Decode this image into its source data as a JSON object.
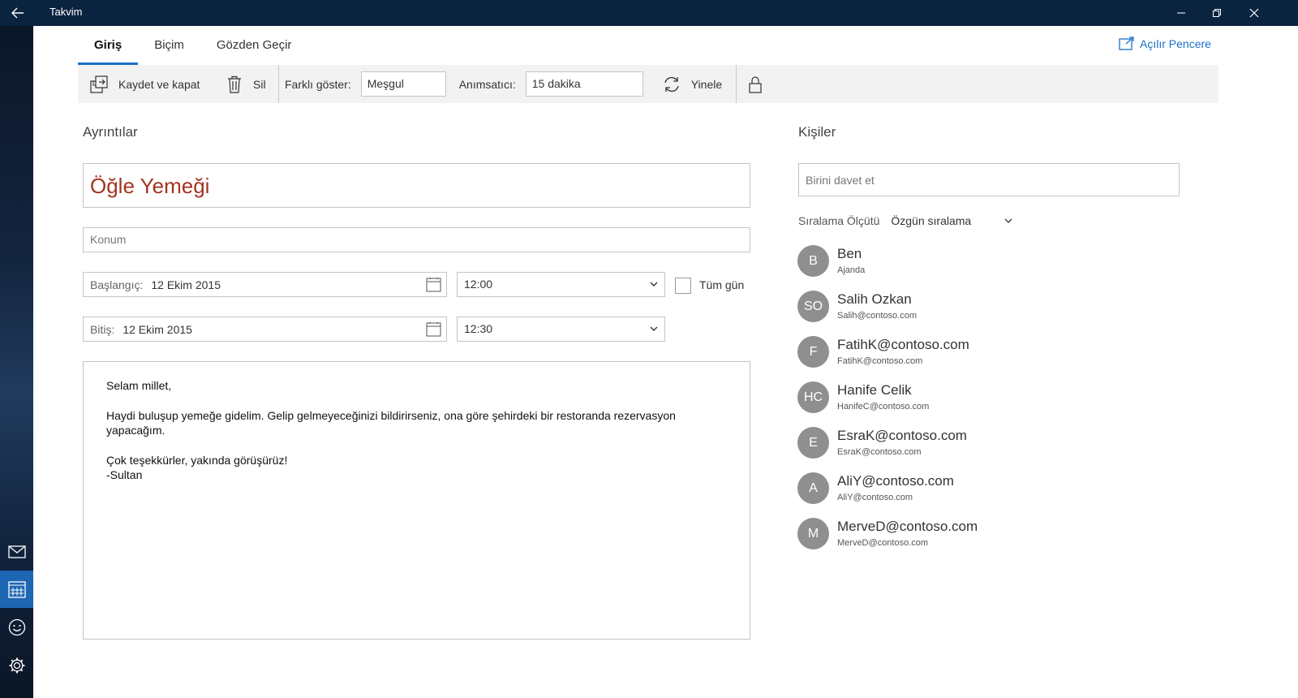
{
  "window": {
    "title": "Takvim"
  },
  "tabs": [
    {
      "label": "Giriş",
      "active": true
    },
    {
      "label": "Biçim",
      "active": false
    },
    {
      "label": "Gözden Geçir",
      "active": false
    }
  ],
  "popout": {
    "label": "Açılır Pencere"
  },
  "toolbar": {
    "save_close": "Kaydet ve kapat",
    "delete": "Sil",
    "show_as_label": "Farklı göster:",
    "show_as_value": "Meşgul",
    "reminder_label": "Anımsatıcı:",
    "reminder_value": "15 dakika",
    "repeat": "Yinele"
  },
  "details": {
    "heading": "Ayrıntılar",
    "subject": "Öğle Yemeği",
    "location_placeholder": "Konum",
    "start_label": "Başlangıç:",
    "start_date": "12 Ekim 2015",
    "start_time": "12:00",
    "end_label": "Bitiş:",
    "end_date": "12 Ekim 2015",
    "end_time": "12:30",
    "all_day_label": "Tüm gün",
    "all_day_checked": false,
    "body_paragraphs": [
      "Selam millet,",
      "Haydi buluşup yemeğe gidelim. Gelip gelmeyeceğinizi bildirirseniz, ona göre şehirdeki bir restoranda rezervasyon yapacağım.",
      "Çok teşekkürler, yakında görüşürüz!\n-Sultan"
    ]
  },
  "people": {
    "heading": "Kişiler",
    "invite_placeholder": "Birini davet et",
    "sort_label": "Sıralama Ölçütü",
    "sort_value": "Özgün sıralama",
    "list": [
      {
        "initials": "B",
        "name": "Ben",
        "email": "Ajanda"
      },
      {
        "initials": "SO",
        "name": "Salih Ozkan",
        "email": "Salih@contoso.com"
      },
      {
        "initials": "F",
        "name": "FatihK@contoso.com",
        "email": "FatihK@contoso.com"
      },
      {
        "initials": "HC",
        "name": "Hanife Celik",
        "email": "HanifeC@contoso.com"
      },
      {
        "initials": "E",
        "name": "EsraK@contoso.com",
        "email": "EsraK@contoso.com"
      },
      {
        "initials": "A",
        "name": "AliY@contoso.com",
        "email": "AliY@contoso.com"
      },
      {
        "initials": "M",
        "name": "MerveD@contoso.com",
        "email": "MerveD@contoso.com"
      }
    ]
  },
  "sidebar": {
    "items": [
      {
        "icon": "mail-icon",
        "active": false
      },
      {
        "icon": "calendar-icon",
        "active": true
      },
      {
        "icon": "feedback-smiley-icon",
        "active": false
      },
      {
        "icon": "settings-gear-icon",
        "active": false
      }
    ]
  },
  "colors": {
    "titlebar": "#0a2440",
    "accent": "#1a6fc7",
    "subject_text": "#a43420",
    "avatar": "#8f8f8f"
  }
}
